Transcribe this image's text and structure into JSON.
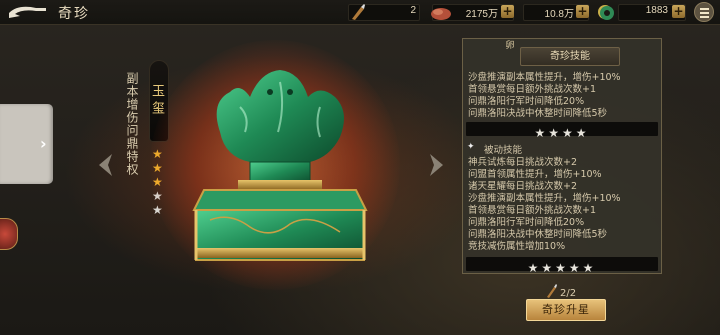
{
  "header": {
    "title": "奇珍",
    "resources": [
      {
        "icon": "brush-icon",
        "value": "2"
      },
      {
        "icon": "ore-pile-icon",
        "value": "2175万"
      },
      {
        "icon": "copper-coin-icon",
        "value": "10.8万"
      },
      {
        "icon": "jade-gem-icon",
        "value": "1883"
      }
    ]
  },
  "treasure": {
    "name": "玉玺",
    "description": "副本增伤问鼎特权",
    "stars": 3,
    "max_stars": 5
  },
  "panel": {
    "badge": "卵",
    "header": "奇珍技能",
    "skill_lines": [
      "沙盘推演副本属性提升，增伤+10%",
      "首领悬赏每日额外挑战次数+1",
      "问鼎洛阳行军时间降低20%",
      "问鼎洛阳决战中休整时间降低5秒"
    ],
    "skill_stars": 4,
    "passive_title": "被动技能",
    "passive_lines": [
      "神兵试炼每日挑战次数+2",
      "问盟首领属性提升，增伤+10%",
      "诸天星耀每日挑战次数+2",
      "沙盘推演副本属性提升，增伤+10%",
      "首领悬赏每日额外挑战次数+1",
      "问鼎洛阳行军时间降低20%",
      "问鼎洛阳决战中休整时间降低5秒",
      "竞技减伤属性增加10%"
    ],
    "passive_stars": 5
  },
  "upgrade": {
    "count": "2/2",
    "button_label": "奇珍升星"
  }
}
